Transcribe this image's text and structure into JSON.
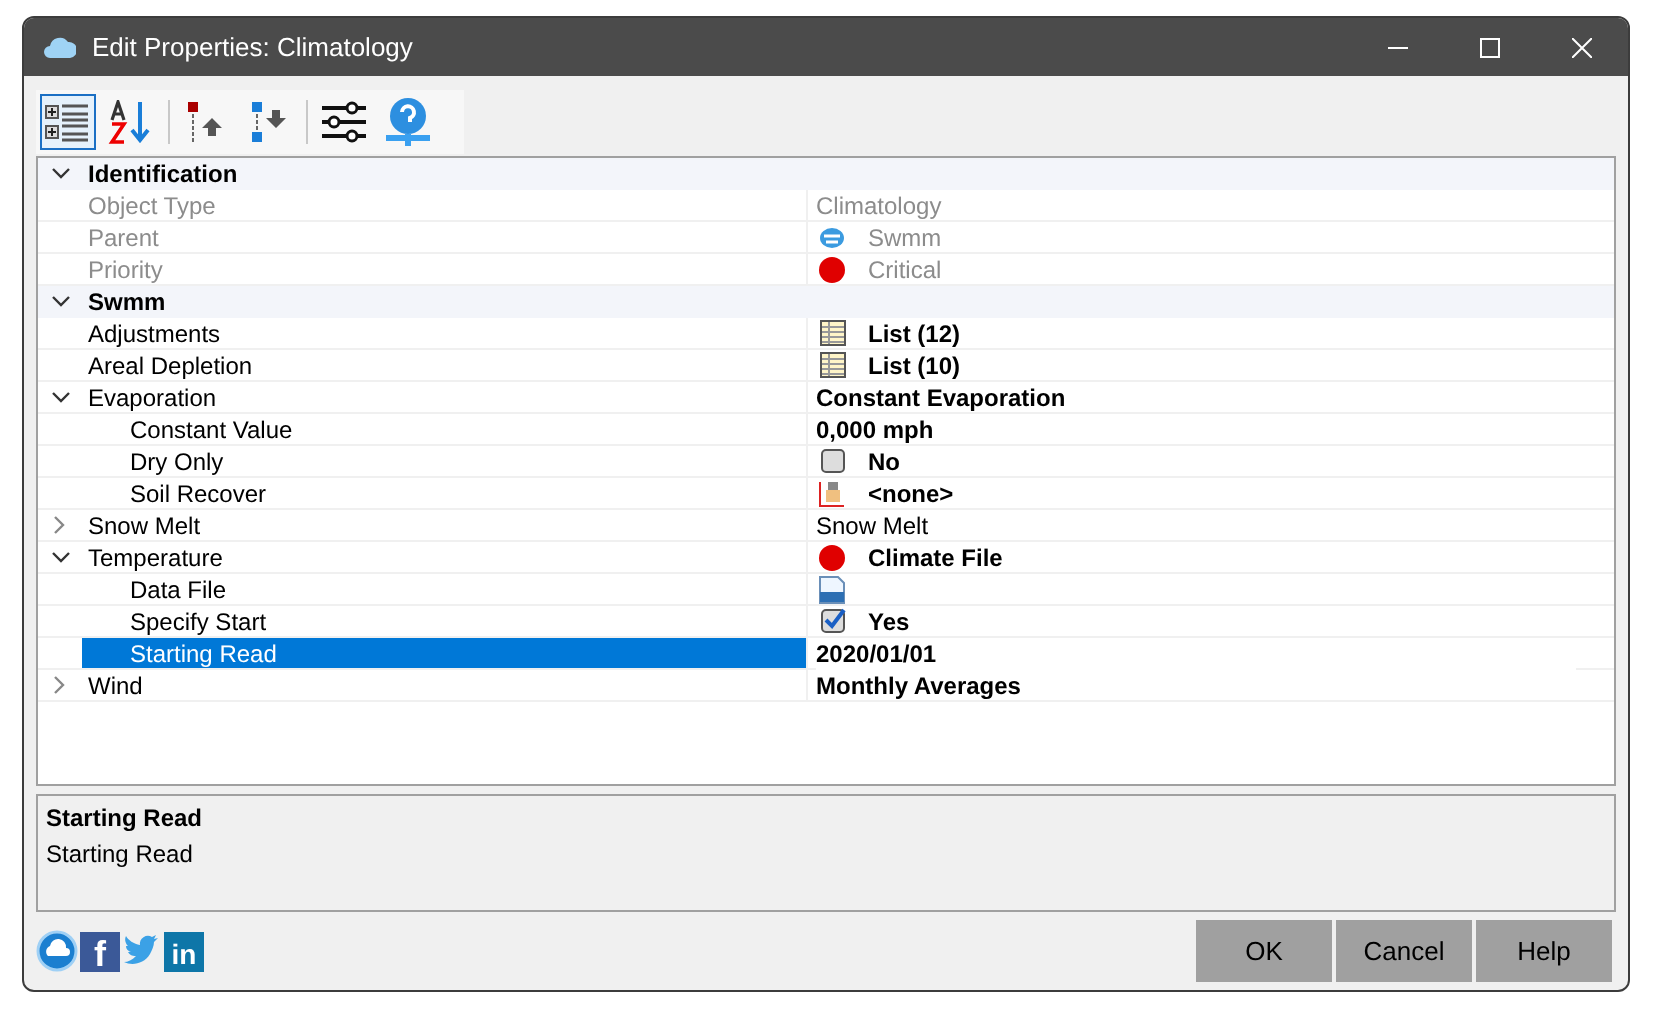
{
  "window": {
    "title": "Edit Properties: Climatology"
  },
  "toolbar": [
    {
      "kind": "categorized",
      "selected": true
    },
    {
      "kind": "alphabetical",
      "selected": false
    },
    {
      "kind": "sep"
    },
    {
      "kind": "up",
      "selected": false
    },
    {
      "kind": "down",
      "selected": false
    },
    {
      "kind": "sep"
    },
    {
      "kind": "sliders",
      "selected": false
    },
    {
      "kind": "help",
      "selected": false
    }
  ],
  "groups": [
    {
      "label": "Identification",
      "expanded": true,
      "rows": [
        {
          "label": "Object Type",
          "value": "Climatology",
          "disabled": true,
          "bold": false,
          "selected": false
        },
        {
          "label": "Parent",
          "value": "Swmm",
          "kind": "parent",
          "disabled": true,
          "bold": false,
          "selected": false
        },
        {
          "label": "Priority",
          "value": "Critical",
          "kind": "dot",
          "disabled": true,
          "bold": false,
          "selected": false
        }
      ]
    },
    {
      "label": "Swmm",
      "expanded": true,
      "rows": [
        {
          "label": "Adjustments",
          "value": "List (12)",
          "kind": "list",
          "disabled": false,
          "bold": true,
          "selected": false
        },
        {
          "label": "Areal Depletion",
          "value": "List (10)",
          "kind": "list",
          "disabled": false,
          "bold": true,
          "selected": false
        },
        {
          "label": "Evaporation",
          "value": "Constant Evaporation",
          "disabled": false,
          "bold": true,
          "selected": false,
          "expanded": true,
          "children": [
            {
              "label": "Constant Value",
              "value": "0,000 mph",
              "disabled": false,
              "bold": true,
              "selected": false
            },
            {
              "label": "Dry Only",
              "value": "No",
              "kind": "checkbox",
              "checked": false,
              "disabled": false,
              "bold": true,
              "selected": false
            },
            {
              "label": "Soil Recover",
              "value": "<none>",
              "kind": "chart",
              "disabled": false,
              "bold": true,
              "selected": false
            }
          ]
        },
        {
          "label": "Snow Melt",
          "value": "Snow Melt",
          "disabled": false,
          "bold": false,
          "selected": false,
          "expanded": false
        },
        {
          "label": "Temperature",
          "value": "Climate File",
          "kind": "dot",
          "disabled": false,
          "bold": true,
          "selected": false,
          "expanded": true,
          "children": [
            {
              "label": "Data File",
              "kind": "file",
              "disabled": false,
              "selected": false
            },
            {
              "label": "Specify Start",
              "value": "Yes",
              "kind": "checkbox",
              "checked": true,
              "disabled": false,
              "bold": true,
              "selected": false
            },
            {
              "label": "Starting Read",
              "value": "2020/01/01",
              "disabled": false,
              "bold": true,
              "selected": true
            }
          ]
        },
        {
          "label": "Wind",
          "value": "Monthly Averages",
          "disabled": false,
          "bold": true,
          "selected": false,
          "expanded": false
        }
      ]
    }
  ],
  "description": {
    "title": "Starting Read",
    "text": "Starting Read"
  },
  "footer_icons": [
    {
      "kind": "logo"
    },
    {
      "kind": "facebook",
      "glyph": "f"
    },
    {
      "kind": "twitter"
    },
    {
      "kind": "linkedin",
      "glyph": "in"
    }
  ],
  "buttons": [
    "OK",
    "Cancel",
    "Help"
  ]
}
